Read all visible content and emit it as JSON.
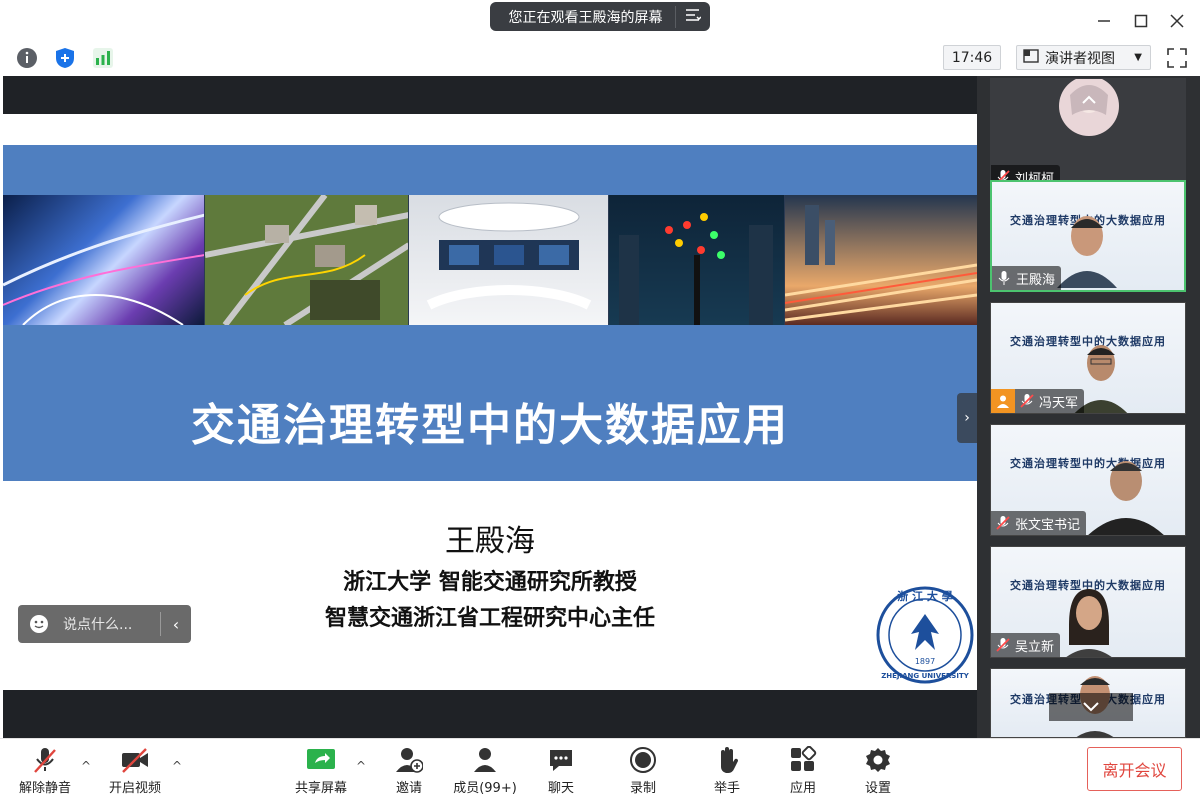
{
  "titlebar": {
    "viewing_banner": "您正在观看王殿海的屏幕",
    "menu_icon": "list-menu-icon"
  },
  "infobar": {
    "clock": "17:46",
    "view_mode": "演讲者视图"
  },
  "slide": {
    "title": "交通治理转型中的大数据应用",
    "presenter": "王殿海",
    "affiliation_1": "浙江大学 智能交通研究所教授",
    "affiliation_2": "智慧交通浙江省工程研究中心主任",
    "logo_year": "1897",
    "logo_text": "ZHEJIANG UNIVERSITY"
  },
  "chat": {
    "placeholder": "说点什么..."
  },
  "participants": [
    {
      "name": "刘柯柯",
      "muted": true
    },
    {
      "name": "王殿海",
      "muted": false,
      "active": true
    },
    {
      "name": "冯天军",
      "muted": true
    },
    {
      "name": "张文宝书记",
      "muted": true
    },
    {
      "name": "吴立新",
      "muted": true
    },
    {
      "name": "",
      "muted": true
    }
  ],
  "thumb_title": "交通治理转型中的大数据应用",
  "toolbar": {
    "unmute": "解除静音",
    "start_video": "开启视频",
    "share_screen": "共享屏幕",
    "invite": "邀请",
    "members": "成员(99+)",
    "chat": "聊天",
    "record": "录制",
    "raise_hand": "举手",
    "apps": "应用",
    "settings": "设置",
    "leave": "离开会议"
  },
  "colors": {
    "slide_band": "#4f7fc0",
    "active_border": "#4cc36f",
    "leave_red": "#e0463e"
  }
}
